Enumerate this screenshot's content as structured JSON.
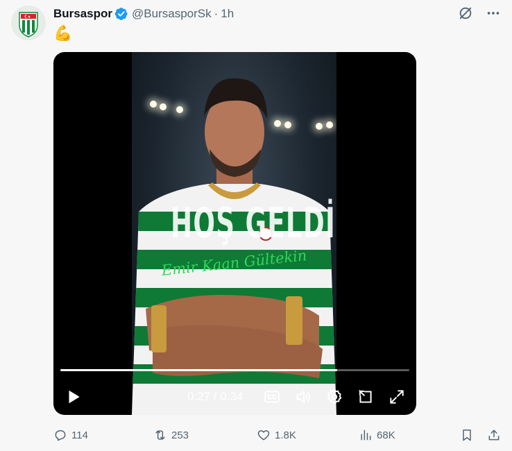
{
  "tweet": {
    "display_name": "Bursaspor",
    "handle": "@BursasporSk",
    "separator": "·",
    "time": "1h",
    "text": "💪",
    "avatar_label": "BURSASPOR"
  },
  "video": {
    "overlay_title": "HOŞ GELDİN",
    "overlay_script": "Emir Kaan Gültekin",
    "time_display": "0:27 / 0:34",
    "progress": 0.794
  },
  "actions": {
    "replies": "114",
    "reposts": "253",
    "likes": "1.8K",
    "views": "68K"
  },
  "colors": {
    "verified": "#1d9bf0",
    "jersey_green": "#0f8a3c",
    "script_green": "#2fd85a",
    "icon_gray": "#536471"
  },
  "icons": [
    "verified-badge-icon",
    "grok-icon",
    "more-icon",
    "play-icon",
    "captions-icon",
    "volume-icon",
    "settings-icon",
    "pip-icon",
    "fullscreen-icon",
    "reply-icon",
    "repost-icon",
    "like-icon",
    "views-icon",
    "bookmark-icon",
    "share-icon"
  ]
}
